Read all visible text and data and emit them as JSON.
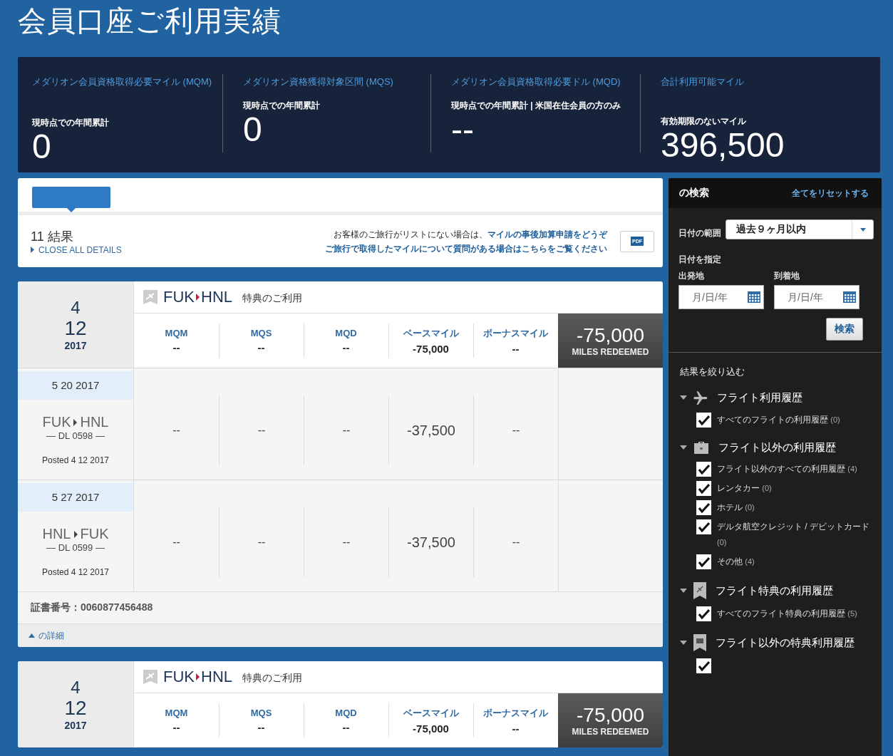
{
  "page_title": "会員口座ご利用実績",
  "stats": [
    {
      "title": "メダリオン会員資格取得必要マイル (MQM)",
      "subtitle": "現時点での年間累計",
      "value": "0"
    },
    {
      "title": "メダリオン資格獲得対象区間 (MQS)",
      "subtitle": "現時点での年間累計",
      "value": "0"
    },
    {
      "title": "メダリオン会員資格取得必要ドル (MQD)",
      "subtitle": "現時点での年間累計 | 米国在住会員の方のみ",
      "value": "--"
    },
    {
      "title": "合計利用可能マイル",
      "subtitle": "有効期限のないマイル",
      "value": "396,500"
    }
  ],
  "results": {
    "count": "11 結果",
    "toggle": "CLOSE ALL DETAILS",
    "notice": "お客様のご旅行がリストにない場合は、",
    "notice_link": "マイルの事後加算申請をどうぞ",
    "question_link": "ご旅行で取得したマイルについて質問がある場合はこちらをご覧ください",
    "pdf": "PDF"
  },
  "transactions": [
    {
      "month": "4",
      "day": "12",
      "year": "2017",
      "origin": "FUK",
      "destination": "HNL",
      "type": "特典のご利用",
      "columns": [
        {
          "label": "MQM",
          "value": "--"
        },
        {
          "label": "MQS",
          "value": "--"
        },
        {
          "label": "MQD",
          "value": "--"
        },
        {
          "label": "ベースマイル",
          "value": "-75,000"
        },
        {
          "label": "ボーナスマイル",
          "value": "--"
        }
      ],
      "total": "-75,000",
      "total_label": "MILES REDEEMED",
      "segments": [
        {
          "date": "5 20 2017",
          "origin": "FUK",
          "destination": "HNL",
          "flight": "— DL 0598 —",
          "posted": "Posted 4 12 2017",
          "values": [
            "--",
            "--",
            "--",
            "-37,500",
            "--"
          ]
        },
        {
          "date": "5 27 2017",
          "origin": "HNL",
          "destination": "FUK",
          "flight": "— DL 0599 —",
          "posted": "Posted 4 12 2017",
          "values": [
            "--",
            "--",
            "--",
            "-37,500",
            "--"
          ]
        }
      ],
      "certificate": "証書番号：0060877456488",
      "details_toggle": "の詳細"
    },
    {
      "month": "4",
      "day": "12",
      "year": "2017",
      "origin": "FUK",
      "destination": "HNL",
      "type": "特典のご利用",
      "columns": [
        {
          "label": "MQM",
          "value": "--"
        },
        {
          "label": "MQS",
          "value": "--"
        },
        {
          "label": "MQD",
          "value": "--"
        },
        {
          "label": "ベースマイル",
          "value": "-75,000"
        },
        {
          "label": "ボーナスマイル",
          "value": "--"
        }
      ],
      "total": "-75,000",
      "total_label": "MILES REDEEMED"
    }
  ],
  "sidebar": {
    "title": "の検索",
    "reset": "全てをリセットする",
    "range_label": "日付の範囲",
    "range_value": "過去９ヶ月以内",
    "date_heading": "日付を指定",
    "from_label": "出発地",
    "from_placeholder": "月/日/年",
    "to_label": "到着地",
    "to_placeholder": "月/日/年",
    "search_button": "検索",
    "filter_heading": "結果を絞り込む",
    "groups": [
      {
        "title": "フライト利用履歴",
        "expanded": true,
        "items": [
          {
            "label": "すべてのフライトの利用履歴",
            "count": "(0)",
            "checked": true
          }
        ]
      },
      {
        "title": "フライト以外の利用履歴",
        "expanded": true,
        "items": [
          {
            "label": "フライト以外のすべての利用履歴",
            "count": "(4)",
            "checked": true
          },
          {
            "label": "レンタカー",
            "count": "(0)",
            "checked": true
          },
          {
            "label": "ホテル",
            "count": "(0)",
            "checked": true
          },
          {
            "label": "デルタ航空クレジット / デビットカード",
            "count": "(0)",
            "checked": true
          },
          {
            "label": "その他",
            "count": "(4)",
            "checked": true
          }
        ]
      },
      {
        "title": "フライト特典の利用履歴",
        "expanded": true,
        "items": [
          {
            "label": "すべてのフライト特典の利用履歴",
            "count": "(5)",
            "checked": true
          }
        ]
      },
      {
        "title": "フライト以外の特典利用履歴",
        "expanded": true,
        "items": [
          {
            "checked": true
          }
        ]
      }
    ]
  }
}
